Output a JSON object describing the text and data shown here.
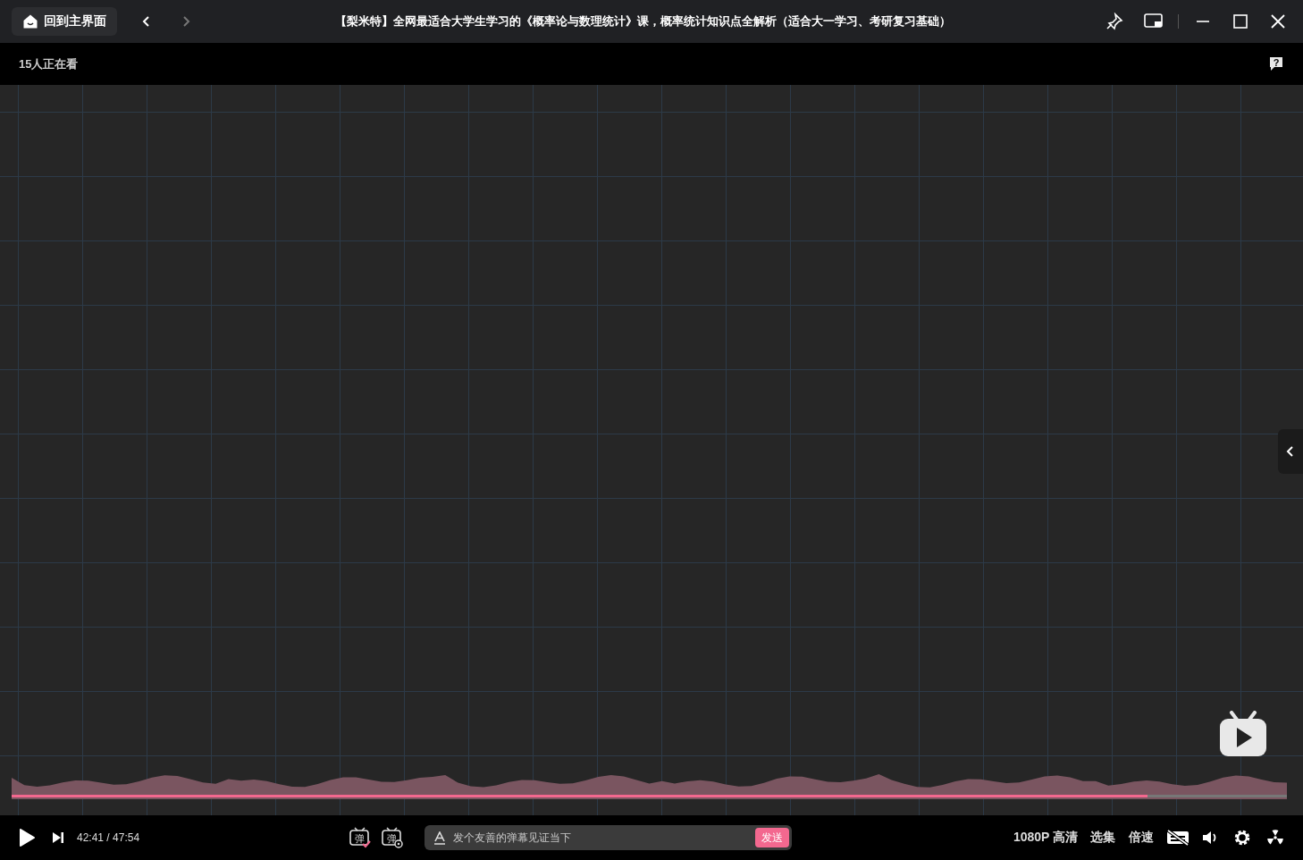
{
  "window": {
    "home_button": "回到主界面",
    "back_disabled": false,
    "forward_disabled": true,
    "title": "【梨米特】全网最适合大学生学习的《概率论与数理统计》课，概率统计知识点全解析（适合大一学习、考研复习基础）"
  },
  "viewers": "15人正在看",
  "help_glyph": "?",
  "player": {
    "progress": {
      "level": 0.891
    },
    "time": "42:41 / 47:54",
    "danmaku_on": true,
    "danmaku_toggle_glyph": "弹",
    "danmaku_settings_glyph": "弹",
    "danmaku_input": {
      "placeholder": "发个友善的弹幕见证当下"
    },
    "send_button": "发送",
    "quality": "1080P 高清",
    "episodes": "选集",
    "speed": "倍速",
    "subtitles_on": false
  }
}
